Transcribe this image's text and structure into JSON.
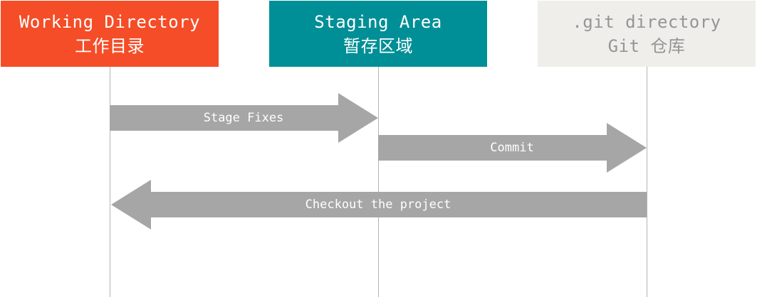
{
  "columns": {
    "working_directory": {
      "title": "Working Directory",
      "subtitle": "工作目录",
      "color": "#f44d27"
    },
    "staging_area": {
      "title": "Staging Area",
      "subtitle": "暂存区域",
      "color": "#008f96"
    },
    "git_directory": {
      "title": ".git directory",
      "subtitle": "Git 仓库",
      "color": "#efeeea"
    }
  },
  "arrows": [
    {
      "label": "Stage Fixes",
      "from": "working_directory",
      "to": "staging_area"
    },
    {
      "label": "Commit",
      "from": "staging_area",
      "to": "git_directory"
    },
    {
      "label": "Checkout the project",
      "from": "git_directory",
      "to": "working_directory"
    }
  ],
  "arrow_color": "#a6a6a6"
}
